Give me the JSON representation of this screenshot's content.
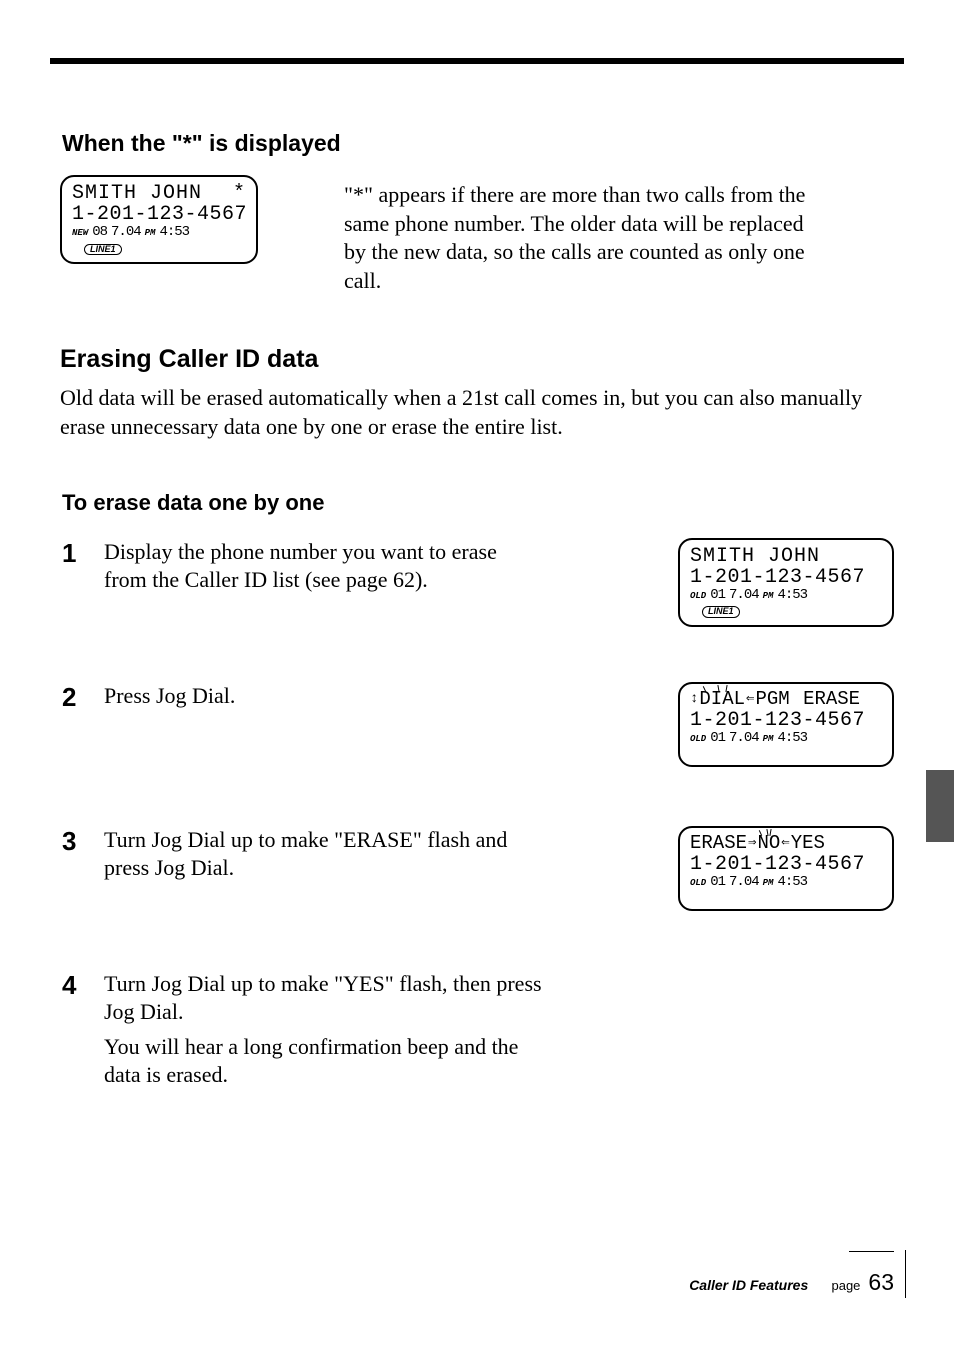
{
  "section1_title": "When the \"*\" is displayed",
  "lcd_top": {
    "name": "SMITH JOHN",
    "star": "*",
    "phone": "1-201-123-4567",
    "badge": "NEW",
    "count": "08",
    "date": "7.04",
    "ampm": "PM",
    "time": "4:53",
    "line": "LINE1"
  },
  "section1_desc": "\"*\" appears if there are more than two calls from the same phone number. The older data will be replaced by the new data, so the calls are counted as only one call.",
  "h2": "Erasing Caller ID data",
  "intro": "Old data will be erased automatically when a 21st call comes in, but you can also manually erase unnecessary data one by one or erase the entire list.",
  "h3": "To erase data one by one",
  "steps": [
    {
      "num": "1",
      "body": "Display the phone number you want to erase from the Caller ID list (see page 62).",
      "lcd": {
        "line1_left": "SMITH JOHN",
        "phone": "1-201-123-4567",
        "badge": "OLD",
        "count": "01",
        "date": "7.04",
        "ampm": "PM",
        "time": "4:53",
        "line": "LINE1"
      }
    },
    {
      "num": "2",
      "body": "Press Jog Dial.",
      "lcd": {
        "menu": [
          "DIAL",
          "PGM",
          "ERASE"
        ],
        "phone": "1-201-123-4567",
        "badge": "OLD",
        "count": "01",
        "date": "7.04",
        "ampm": "PM",
        "time": "4:53"
      }
    },
    {
      "num": "3",
      "body": "Turn Jog Dial up to make \"ERASE\" flash and press Jog Dial.",
      "lcd": {
        "menu": [
          "ERASE",
          "NO",
          "YES"
        ],
        "phone": "1-201-123-4567",
        "badge": "OLD",
        "count": "01",
        "date": "7.04",
        "ampm": "PM",
        "time": "4:53"
      }
    },
    {
      "num": "4",
      "body": "Turn Jog Dial up to make \"YES\" flash, then press Jog Dial.",
      "body2": "You will hear a long confirmation beep and the data is erased."
    }
  ],
  "footer": {
    "label": "Caller ID Features",
    "pagelabel": "page",
    "pagenum": "63"
  }
}
